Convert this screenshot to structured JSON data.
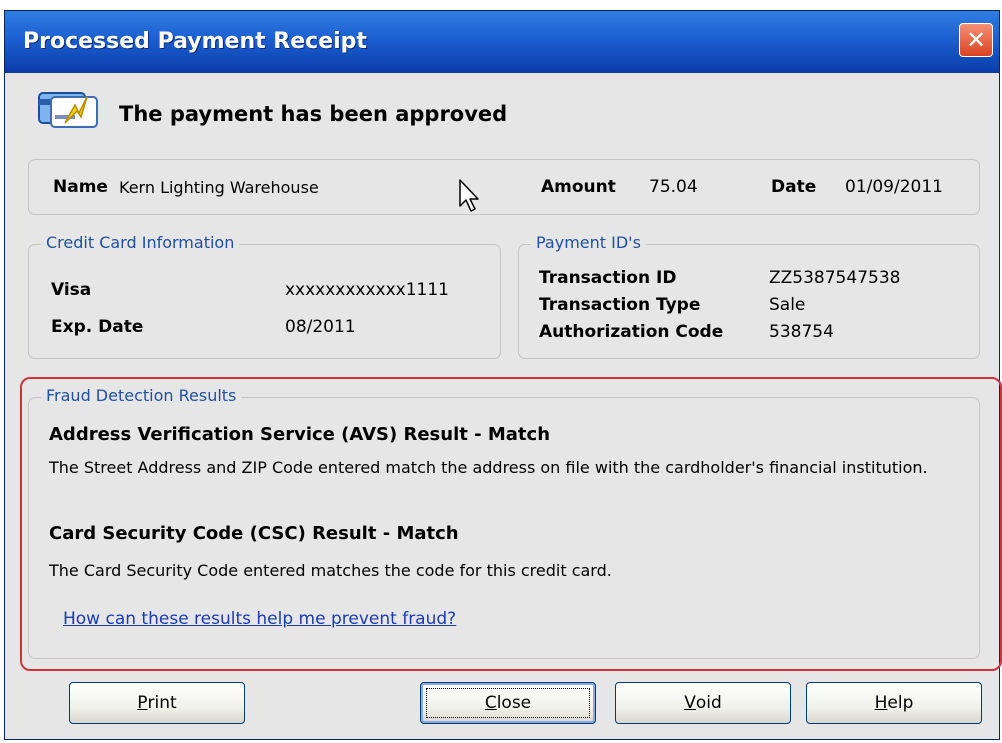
{
  "window": {
    "title": "Processed Payment Receipt",
    "close_glyph": "✕"
  },
  "status": {
    "message": "The payment has been approved",
    "icon": "credit-card-approved-icon"
  },
  "summary": {
    "name_label": "Name",
    "name_value": "Kern Lighting Warehouse",
    "amount_label": "Amount",
    "amount_value": "75.04",
    "date_label": "Date",
    "date_value": "01/09/2011"
  },
  "credit_card": {
    "legend": "Credit Card Information",
    "card_label": "Visa",
    "card_number": "xxxxxxxxxxxx1111",
    "exp_label": "Exp. Date",
    "exp_value": "08/2011"
  },
  "payment_ids": {
    "legend": "Payment ID's",
    "transaction_id_label": "Transaction ID",
    "transaction_id_value": "ZZ5387547538",
    "transaction_type_label": "Transaction Type",
    "transaction_type_value": "Sale",
    "auth_code_label": "Authorization Code",
    "auth_code_value": "538754"
  },
  "fraud": {
    "legend": "Fraud Detection Results",
    "avs_heading": "Address Verification Service (AVS) Result  - Match",
    "avs_text": "The Street Address and ZIP Code entered match the address on file with the cardholder's financial institution.",
    "csc_heading": "Card Security Code (CSC) Result  - Match",
    "csc_text": "The Card Security Code entered matches the code for this credit card.",
    "help_link": "How can these results help me prevent fraud?",
    "highlight_color": "#d0343a"
  },
  "buttons": {
    "print_mnemonic": "P",
    "print_rest": "rint",
    "close_mnemonic": "C",
    "close_rest": "lose",
    "void_mnemonic": "V",
    "void_rest": "oid",
    "help_mnemonic": "H",
    "help_rest": "elp"
  },
  "colors": {
    "titlebar": "#1c5fd0",
    "legend_text": "#2050a0",
    "link": "#1a3bb3"
  }
}
